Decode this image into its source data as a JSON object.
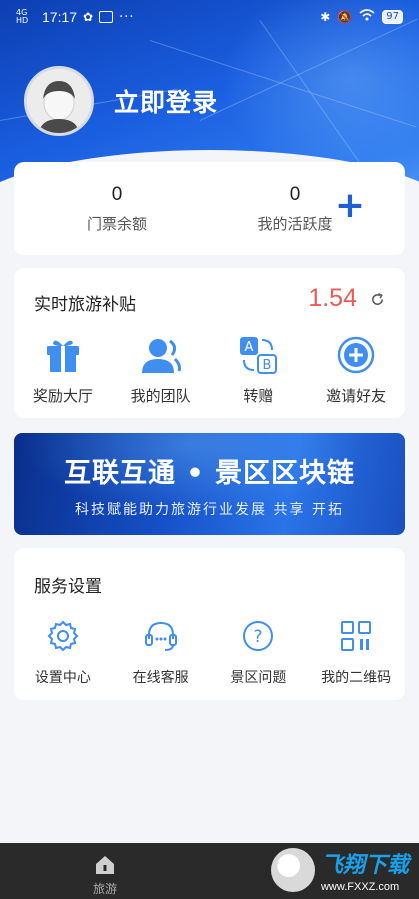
{
  "status_bar": {
    "signal": "4G HD",
    "time": "17:17",
    "more": "···",
    "battery": "97"
  },
  "profile": {
    "login_label": "立即登录"
  },
  "stats": {
    "ticket_balance": {
      "value": "0",
      "label": "门票余额"
    },
    "activity": {
      "value": "0",
      "label": "我的活跃度"
    },
    "add_symbol": "+"
  },
  "subsidy": {
    "title": "实时旅游补贴",
    "value": "1.54",
    "value_color": "#ea5b55",
    "items": [
      {
        "label": "奖励大厅",
        "icon": "gift-icon"
      },
      {
        "label": "我的团队",
        "icon": "team-icon"
      },
      {
        "label": "转赠",
        "icon": "transfer-icon"
      },
      {
        "label": "邀请好友",
        "icon": "invite-icon"
      }
    ]
  },
  "banner": {
    "title": "互联互通 • 景区区块链",
    "subtitle": "科技赋能助力旅游行业发展 共享 开拓"
  },
  "services": {
    "title": "服务设置",
    "items": [
      {
        "label": "设置中心",
        "icon": "gear-icon"
      },
      {
        "label": "在线客服",
        "icon": "headset-icon"
      },
      {
        "label": "景区问题",
        "icon": "question-icon"
      },
      {
        "label": "我的二维码",
        "icon": "qrcode-icon"
      }
    ]
  },
  "tabbar": {
    "tab_label": "旅游"
  },
  "watermark": {
    "text": "飞翔下载",
    "url": "www.FXXZ.com"
  },
  "colors": {
    "accent": "#1f5fd6",
    "header_blue": "#1a5ee0",
    "icon_blue": "#3f8ef0"
  }
}
